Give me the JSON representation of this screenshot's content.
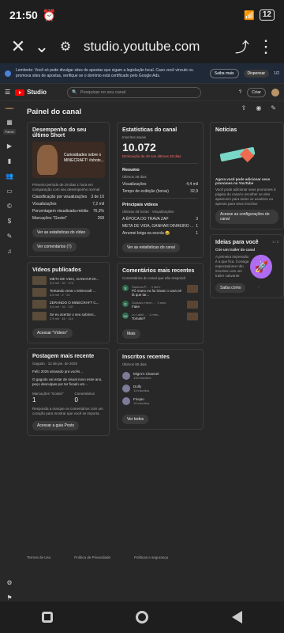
{
  "status": {
    "time": "21:50",
    "battery": "12"
  },
  "browser": {
    "url": "studio.youtube.com"
  },
  "banner": {
    "text": "Lembrete: Você só pode divulgar sites de apostas que sigam a legislação local. Caso você vincule ou promova sites de apostas, verifique se o domínio está certificado pelo Google Ads.",
    "learn": "Saiba mais",
    "dismiss": "Dispensar",
    "pager": "1/2"
  },
  "header": {
    "brand": "Studio",
    "search": "Pesquisar no seu canal",
    "create": "Criar"
  },
  "sidebar": {
    "tag": "Painel"
  },
  "page": {
    "title": "Painel do canal"
  },
  "last_short": {
    "title": "Desempenho do seu último Short",
    "thumb_caption": "Curiosidades sobre o MINECRAFT! #shots...",
    "desc": "Primeiro período de 29 dias 1 hora em comparação com seu desempenho normal",
    "rows": [
      {
        "label": "Classificação por visualizações",
        "value": "3 de 10"
      },
      {
        "label": "Visualizações",
        "value": "7,2 mil"
      },
      {
        "label": "Porcentagem visualizada média",
        "value": "76,3%"
      },
      {
        "label": "Marcações \"Gostei\"",
        "value": "268"
      }
    ],
    "btn1": "Ver as estatísticas do vídeo",
    "btn2": "Ver comentários (7)"
  },
  "videos": {
    "title": "Vídeos publicados",
    "items": [
      {
        "t": "META DE VIDA, GANHAR DI...",
        "m": "9,6 mil · 32 · 173"
      },
      {
        "t": "Tentando zerar o Minecraft ...",
        "m": "4,6 mil · 2 · 24"
      },
      {
        "t": "ZERANDO O MINECRAFT C...",
        "m": "3,6 mil · 31 · 137"
      },
      {
        "t": "Se eu acertar o seu subinsc...",
        "m": "2,9 mil · 16 · 114"
      }
    ],
    "btn": "Acessar \"Vídeos\""
  },
  "post": {
    "title": "Postagem mais recente",
    "author": "Gaguito",
    "date": "12 de jan. de 2025",
    "line1": "Feliz 2025 atrasado pra vocês...",
    "line2": "O gaguito vai estar de visual novo esse ano, peço desculpas por ter ficado um...",
    "l1": "Marcações \"Gostei\"",
    "v1": "1",
    "l2": "Comentários",
    "v2": "0",
    "desc": "Responda a marque os comentários com um coração para mostrar que você se importa.",
    "btn": "Acessar a guia Posts"
  },
  "stats": {
    "title": "Estatísticas do canal",
    "sub_label": "Inscritos atuais",
    "subs": "10.072",
    "delta": "Diminuição de 40 nos últimos 28 dias",
    "summary": "Resumo",
    "period": "Últimos 28 dias",
    "rows": [
      {
        "label": "Visualizações",
        "value": "4,4 mil"
      },
      {
        "label": "Tempo de exibição (horas)",
        "value": "32,9"
      }
    ],
    "top": "Principais vídeos",
    "top_period": "Últimas 48 horas · Visualizações",
    "top_items": [
      {
        "t": "A ÉPOCA DO TRAVA ZAP",
        "v": "3"
      },
      {
        "t": "META DE VIDA, GANHAR DINHEIRO ...",
        "v": "1"
      },
      {
        "t": "Arrumei briga na escola 😂",
        "v": "1"
      }
    ],
    "btn": "Ver as estatísticas do canal"
  },
  "comments": {
    "title": "Comentários mais recentes",
    "sub": "Comentários do canal que não respondi",
    "items": [
      {
        "a": "Samuca P...",
        "time": "1 sem.",
        "t": "Pô mano eu fui travar o cara né lá que tar..."
      },
      {
        "a": "Gustavo Henri...",
        "time": "3 sem.",
        "t": "Fake"
      },
      {
        "a": "Lu Lakhl...",
        "time": "1 mês...",
        "t": "Tomate?"
      }
    ],
    "btn": "Mais"
  },
  "subs": {
    "title": "Inscritos recentes",
    "period": "Últimos 90 dias",
    "items": [
      {
        "n": "Migro's Channel",
        "c": "133 inscritos"
      },
      {
        "n": "Dolfy",
        "c": "13 inscritos"
      },
      {
        "n": "Friejao",
        "c": "10 inscritos"
      }
    ],
    "btn": "Ver todos"
  },
  "news": {
    "title": "Notícias",
    "headline": "Agora você pode adicionar seus pronomes no YouTube",
    "text": "Você pode adicionar seus pronomes à página do canal e escolher se eles aparecem para todos os usuários ou apenas para seus inscritos",
    "btn": "Acesse as configurações do canal"
  },
  "ideas": {
    "title": "Ideias para você",
    "pager": "1 / 3",
    "head": "Crie um trailer do canal",
    "text": "A primeira impressão é a que fica. Consiga espectadores não inscritos com um trailer cativante",
    "btn": "Saiba como"
  },
  "footer": {
    "a": "Termos de Uso",
    "b": "Política de Privacidade",
    "c": "Políticas e segurança"
  }
}
